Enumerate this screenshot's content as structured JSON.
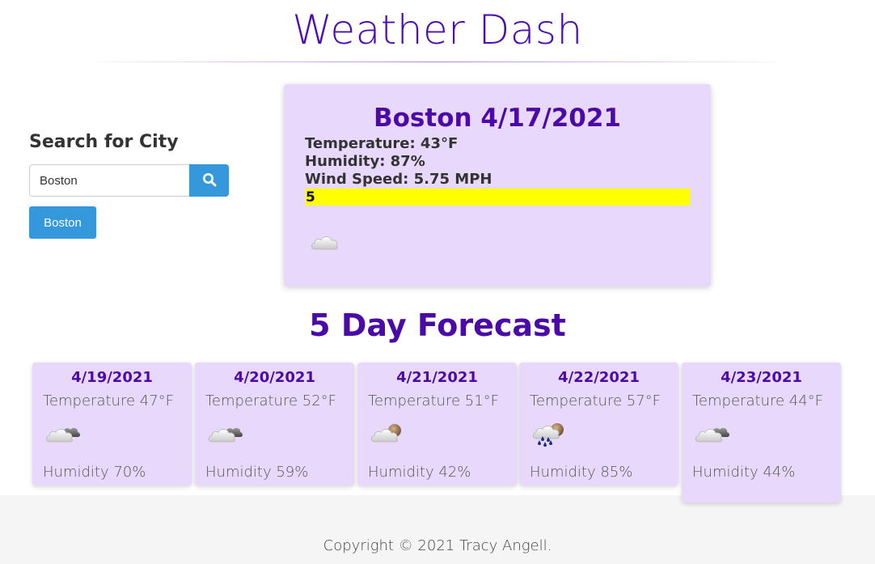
{
  "app": {
    "title": "Weather Dash"
  },
  "search": {
    "heading": "Search for City",
    "value": "Boston",
    "placeholder": ""
  },
  "history": [
    {
      "label": "Boston"
    }
  ],
  "current": {
    "heading": "Boston 4/17/2021",
    "temperature": "Temperature: 43°F",
    "humidity": "Humidity: 87%",
    "wind": "Wind Speed: 5.75 MPH",
    "uv_index": "5",
    "uv_color": "#ffff00",
    "icon": "cloud-icon"
  },
  "forecast": {
    "heading": "5 Day Forecast",
    "days": [
      {
        "date": "4/19/2021",
        "temp": "Temperature 47°F",
        "humidity": "Humidity 70%",
        "icon": "broken-clouds-icon"
      },
      {
        "date": "4/20/2021",
        "temp": "Temperature 52°F",
        "humidity": "Humidity 59%",
        "icon": "broken-clouds-icon"
      },
      {
        "date": "4/21/2021",
        "temp": "Temperature 51°F",
        "humidity": "Humidity 42%",
        "icon": "partly-cloudy-icon"
      },
      {
        "date": "4/22/2021",
        "temp": "Temperature 57°F",
        "humidity": "Humidity 85%",
        "icon": "rain-icon"
      },
      {
        "date": "4/23/2021",
        "temp": "Temperature 44°F",
        "humidity": "Humidity 44%",
        "icon": "broken-clouds-icon"
      }
    ]
  },
  "footer": {
    "text": "Copyright © 2021 Tracy Angell."
  },
  "colors": {
    "accent": "#4b0aa8",
    "card": "#e8d8fb",
    "button": "#3498db"
  }
}
